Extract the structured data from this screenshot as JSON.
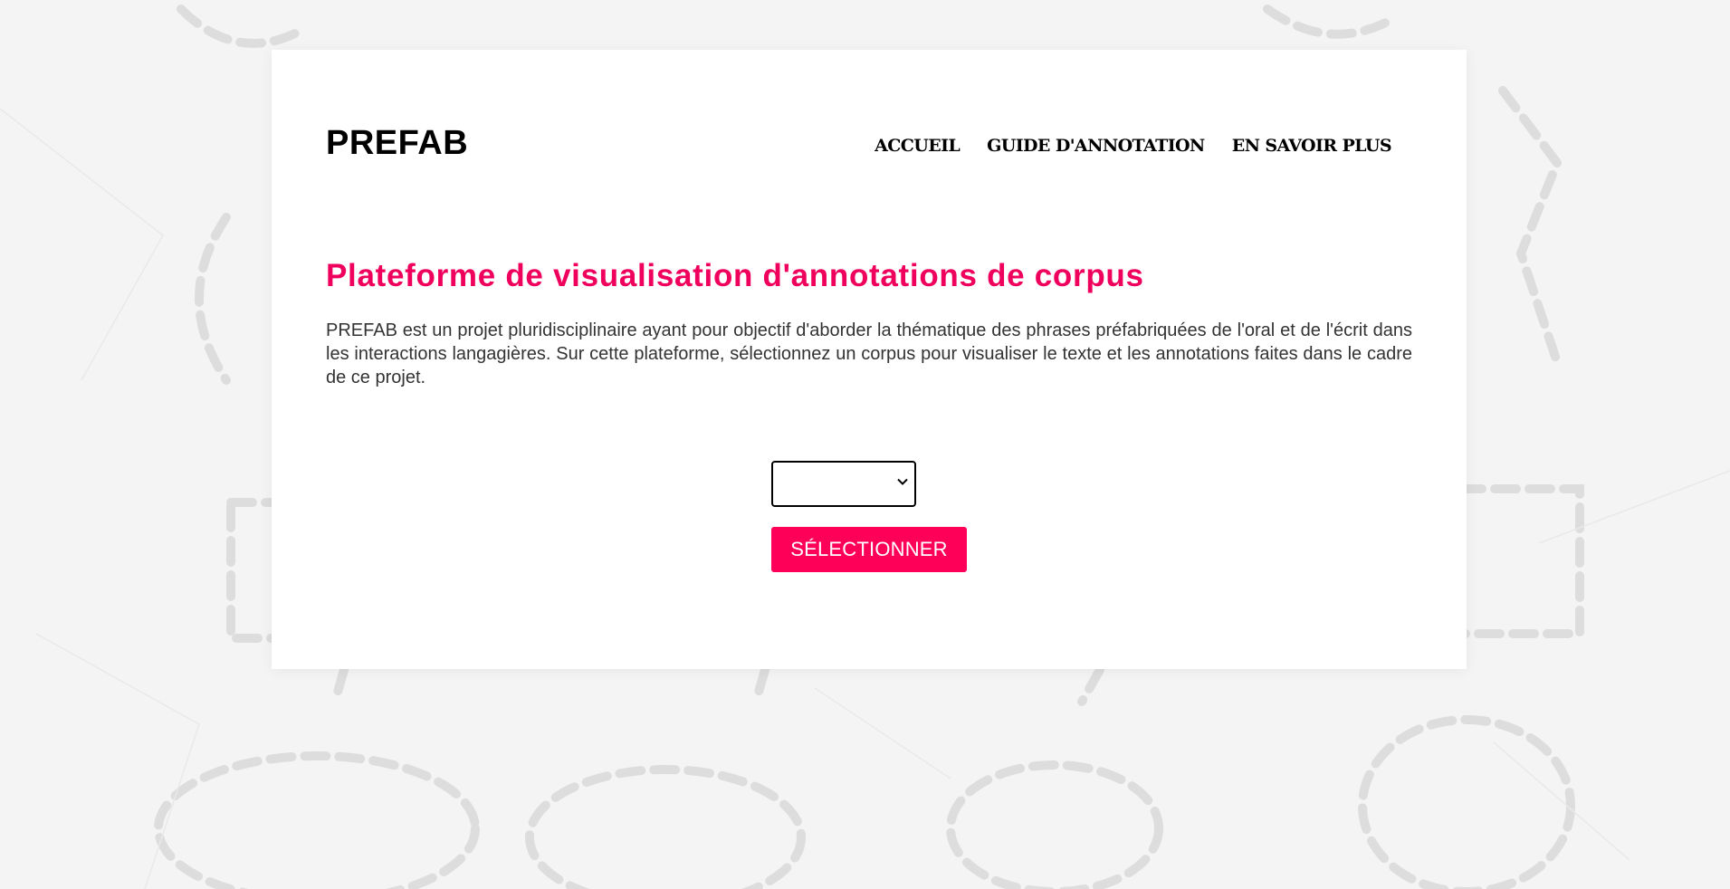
{
  "header": {
    "brand": "PREFAB",
    "nav": [
      {
        "label": "ACCUEIL"
      },
      {
        "label": "GUIDE D'ANNOTATION"
      },
      {
        "label": "EN SAVOIR PLUS"
      }
    ]
  },
  "main": {
    "title": "Plateforme de visualisation d'annotations de corpus",
    "description": "PREFAB est un projet pluridisciplinaire ayant pour objectif d'aborder la thématique des phrases préfabriquées de l'oral et de l'écrit dans les interactions langagières. Sur cette plateforme, sélectionnez un corpus pour visualiser le texte et les annotations faites dans le cadre de ce projet.",
    "corpus_select": {
      "value": "",
      "icon": "chevron-down-icon"
    },
    "select_button_label": "SÉLECTIONNER"
  },
  "colors": {
    "accent": "#f0005d",
    "button": "#ff0059",
    "background": "#f4f4f4",
    "card": "#ffffff"
  }
}
